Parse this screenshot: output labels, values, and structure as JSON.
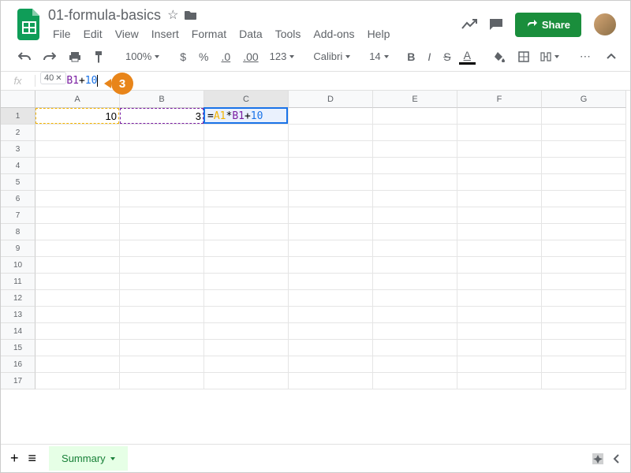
{
  "doc_title": "01-formula-basics",
  "menus": [
    "File",
    "Edit",
    "View",
    "Insert",
    "Format",
    "Data",
    "Tools",
    "Add-ons",
    "Help"
  ],
  "share_label": "Share",
  "zoom": "100%",
  "decimals_dec": ".0",
  "decimals_inc": ".00",
  "number_format": "123",
  "font_name": "Calibri",
  "font_size": "14",
  "result_hint": "40",
  "formula_parts": {
    "eq": "=",
    "ref1": "A1",
    "op1": "*",
    "ref2": "B1",
    "op2": "+",
    "num": "10"
  },
  "callout_number": "3",
  "columns": [
    "A",
    "B",
    "C",
    "D",
    "E",
    "F",
    "G"
  ],
  "rows": [
    "1",
    "2",
    "3",
    "4",
    "5",
    "6",
    "7",
    "8",
    "9",
    "10",
    "11",
    "12",
    "13",
    "14",
    "15",
    "16",
    "17"
  ],
  "cells": {
    "A1": "10",
    "B1": "3"
  },
  "active_cell": "C1",
  "sheet_name": "Summary"
}
